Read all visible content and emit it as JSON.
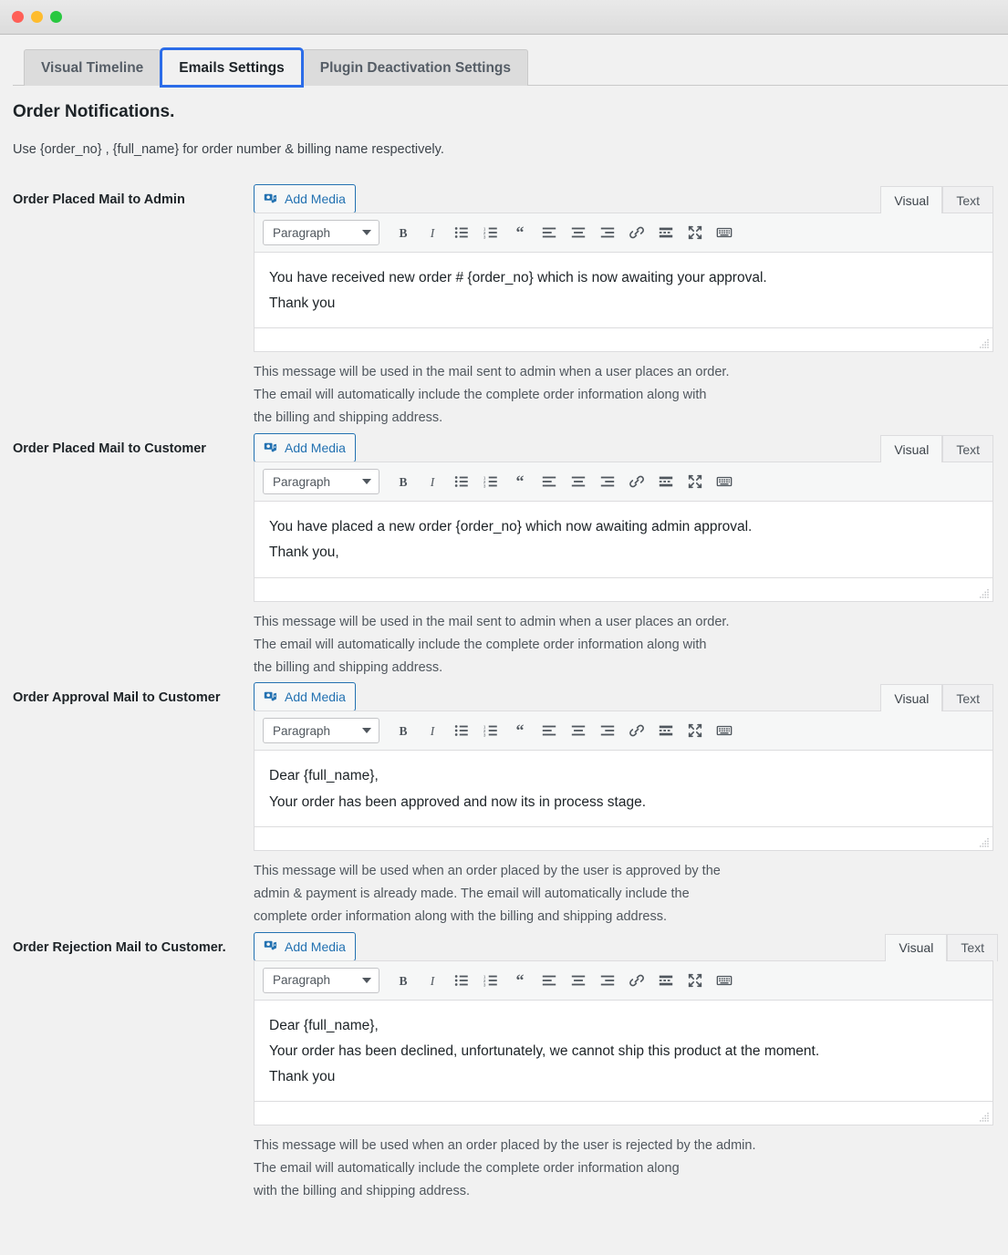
{
  "window": {
    "traffic_lights": [
      "close",
      "minimize",
      "zoom"
    ],
    "colors": {
      "accent_blue": "#2271b1",
      "focus_ring": "#2b6ce8",
      "page_bg": "#f1f1f1",
      "tab_inactive_bg": "#dcdcdc",
      "editor_border": "#dcdcde",
      "toolbar_bg": "#f6f7f7"
    }
  },
  "tabs": [
    {
      "label": "Visual Timeline",
      "active": false
    },
    {
      "label": "Emails Settings",
      "active": true
    },
    {
      "label": "Plugin Deactivation Settings",
      "active": false
    }
  ],
  "page": {
    "title": "Order Notifications.",
    "subtitle": "Use {order_no} , {full_name} for order number & billing name respectively."
  },
  "editor_common": {
    "add_media_label": "Add Media",
    "add_media_icon": "media-icon",
    "visual_tab": "Visual",
    "text_tab": "Text",
    "format_select_value": "Paragraph",
    "toolbar_buttons": [
      {
        "name": "bold-icon",
        "title": "Bold"
      },
      {
        "name": "italic-icon",
        "title": "Italic"
      },
      {
        "name": "bulleted-list-icon",
        "title": "Bulleted list"
      },
      {
        "name": "numbered-list-icon",
        "title": "Numbered list"
      },
      {
        "name": "blockquote-icon",
        "title": "Blockquote"
      },
      {
        "name": "align-left-icon",
        "title": "Align left"
      },
      {
        "name": "align-center-icon",
        "title": "Align center"
      },
      {
        "name": "align-right-icon",
        "title": "Align right"
      },
      {
        "name": "link-icon",
        "title": "Insert/edit link"
      },
      {
        "name": "read-more-icon",
        "title": "Insert Read More tag"
      },
      {
        "name": "fullscreen-icon",
        "title": "Distraction-free writing mode"
      },
      {
        "name": "keyboard-shortcuts-icon",
        "title": "Keyboard shortcuts"
      }
    ]
  },
  "sections": [
    {
      "label": "Order Placed Mail to Admin",
      "body": [
        "You have received new order # {order_no} which is now awaiting your approval.",
        "Thank you"
      ],
      "help": [
        "This message will be used in the mail sent to admin when a user places an order.",
        "The email will automatically include the complete order information along with",
        "the billing and shipping address."
      ]
    },
    {
      "label": "Order Placed Mail to Customer",
      "body": [
        "You have placed a new order {order_no} which now awaiting admin approval.",
        "Thank you,"
      ],
      "help": [
        "This message will be used in the mail sent to admin when a user places an order.",
        "The email will automatically include the complete order information along with",
        "the billing and shipping address."
      ]
    },
    {
      "label": "Order Approval Mail to Customer",
      "body": [
        "Dear {full_name},",
        "Your order has been approved and now its in process stage."
      ],
      "help": [
        "This message will be used when an order placed by the user is approved by the",
        "admin & payment is already made. The email will automatically include the",
        "complete order information along with the billing and shipping address."
      ]
    },
    {
      "label": "Order Rejection Mail to Customer.",
      "body": [
        "Dear {full_name},",
        "Your order has been declined, unfortunately, we cannot ship this product at the moment.",
        "Thank you"
      ],
      "help": [
        "This message will be used when an order placed by the user is rejected by the admin.",
        "The email will automatically include the complete order information along",
        "with the billing and shipping address."
      ]
    }
  ]
}
